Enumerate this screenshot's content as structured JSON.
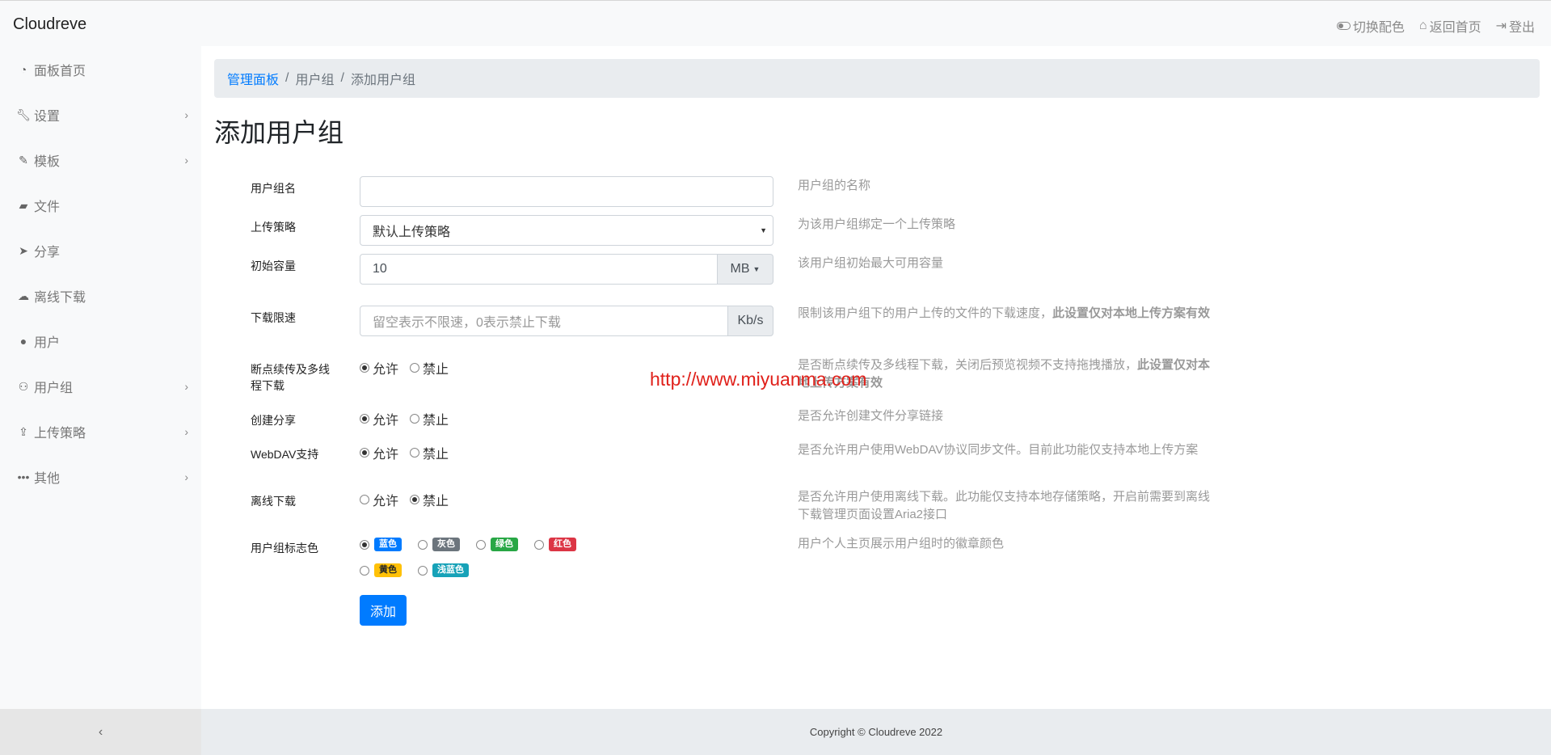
{
  "brand": "Cloudreve",
  "topnav": {
    "toggle_theme": "切换配色",
    "home": "返回首页",
    "logout": "登出"
  },
  "sidebar": {
    "items": [
      {
        "label": "面板首页",
        "icon": "dashboard-icon",
        "chevron": false
      },
      {
        "label": "设置",
        "icon": "wrench-icon",
        "chevron": true
      },
      {
        "label": "模板",
        "icon": "brush-icon",
        "chevron": true
      },
      {
        "label": "文件",
        "icon": "folder-icon",
        "chevron": false
      },
      {
        "label": "分享",
        "icon": "paper-plane-icon",
        "chevron": false
      },
      {
        "label": "离线下载",
        "icon": "cloud-download-icon",
        "chevron": false
      },
      {
        "label": "用户",
        "icon": "user-icon",
        "chevron": false
      },
      {
        "label": "用户组",
        "icon": "users-icon",
        "chevron": true
      },
      {
        "label": "上传策略",
        "icon": "upload-icon",
        "chevron": true
      },
      {
        "label": "其他",
        "icon": "ellipsis-icon",
        "chevron": true
      }
    ],
    "collapse": "‹"
  },
  "breadcrumb": {
    "root": "管理面板",
    "parent": "用户组",
    "current": "添加用户组",
    "separator": "/"
  },
  "page_title": "添加用户组",
  "form": {
    "group_name": {
      "label": "用户组名",
      "value": "",
      "help": "用户组的名称"
    },
    "upload_policy": {
      "label": "上传策略",
      "value": "默认上传策略",
      "help": "为该用户组绑定一个上传策略"
    },
    "initial_capacity": {
      "label": "初始容量",
      "value": "10",
      "unit": "MB",
      "help": "该用户组初始最大可用容量"
    },
    "download_speed": {
      "label": "下载限速",
      "placeholder": "留空表示不限速，0表示禁止下载",
      "unit": "Kb/s",
      "help": "限制该用户组下的用户上传的文件的下载速度，",
      "help_bold": "此设置仅对本地上传方案有效"
    },
    "resume_multithread": {
      "label_line1": "断点续传及多线",
      "label_line2": "程下载",
      "allow": "允许",
      "deny": "禁止",
      "selected": "allow",
      "help": "是否断点续传及多线程下载，关闭后预览视频不支持拖拽播放，",
      "help_bold": "此设置仅对本地上传方案有效"
    },
    "create_share": {
      "label": "创建分享",
      "allow": "允许",
      "deny": "禁止",
      "selected": "allow",
      "help": "是否允许创建文件分享链接"
    },
    "webdav": {
      "label": "WebDAV支持",
      "allow": "允许",
      "deny": "禁止",
      "selected": "allow",
      "help": "是否允许用户使用WebDAV协议同步文件。目前此功能仅支持本地上传方案"
    },
    "offline_download": {
      "label": "离线下载",
      "allow": "允许",
      "deny": "禁止",
      "selected": "deny",
      "help": "是否允许用户使用离线下载。此功能仅支持本地存储策略，开启前需要到离线下载管理页面设置Aria2接口"
    },
    "badge_color": {
      "label": "用户组标志色",
      "help": "用户个人主页展示用户组时的徽章颜色",
      "options": [
        {
          "label": "蓝色",
          "color": "#007bff",
          "selected": true
        },
        {
          "label": "灰色",
          "color": "#6c757d",
          "selected": false
        },
        {
          "label": "绿色",
          "color": "#28a745",
          "selected": false
        },
        {
          "label": "红色",
          "color": "#dc3545",
          "selected": false
        },
        {
          "label": "黄色",
          "color": "#ffc107",
          "selected": false
        },
        {
          "label": "浅蓝色",
          "color": "#17a2b8",
          "selected": false
        }
      ]
    },
    "submit": "添加"
  },
  "watermark": "http://www.miyuanma.com",
  "footer": "Copyright © Cloudreve 2022"
}
